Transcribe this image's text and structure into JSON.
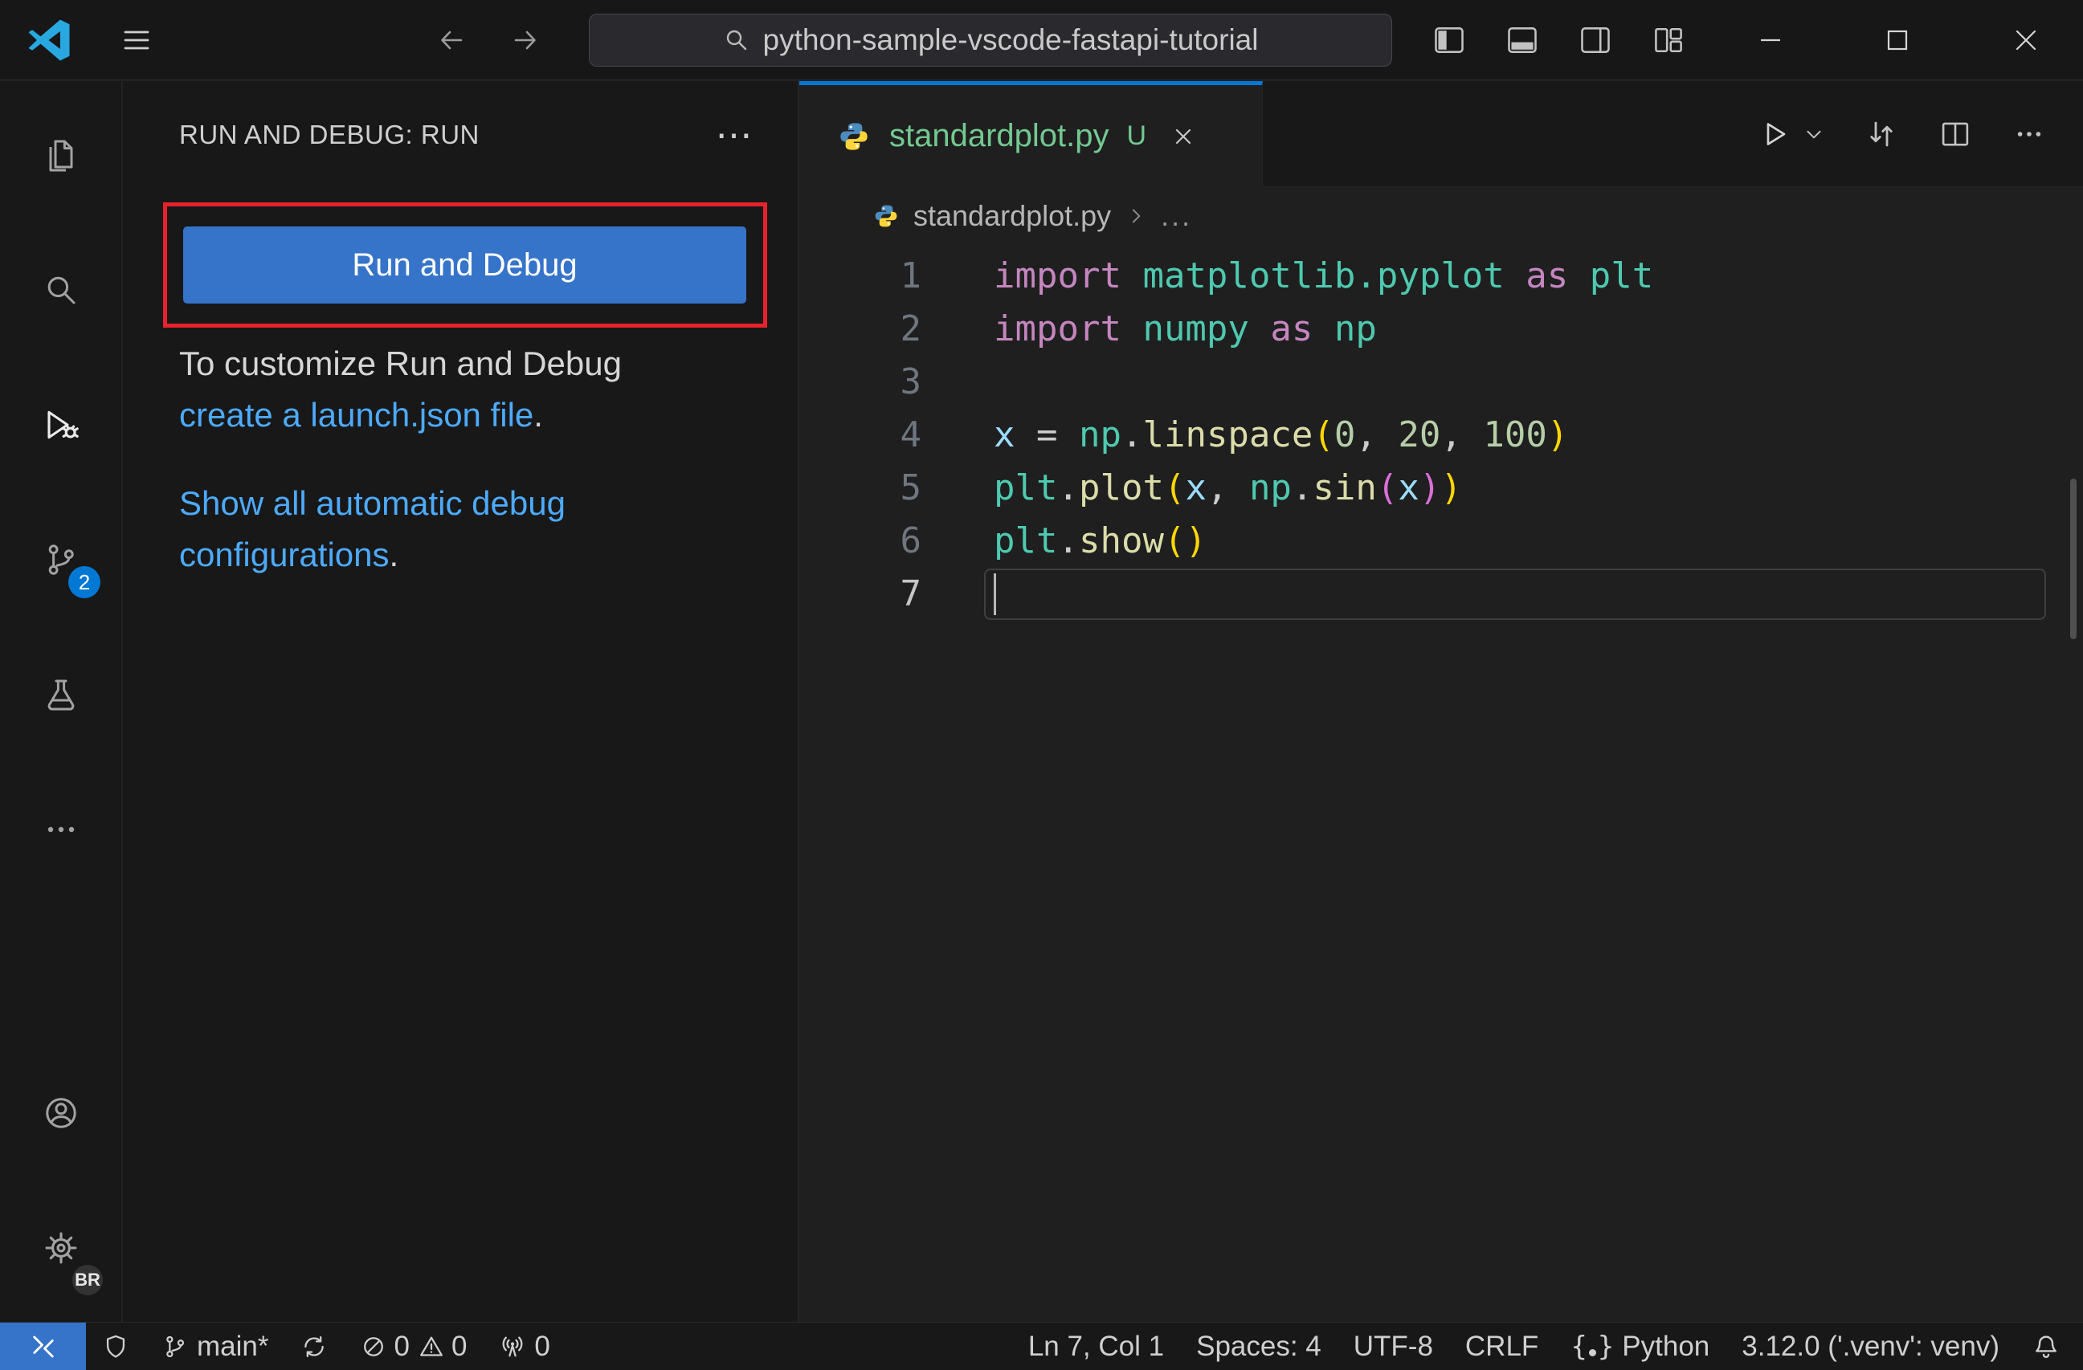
{
  "colors": {
    "accent_blue": "#3574c9",
    "tab_accent": "#0078d4",
    "link_blue": "#4daafc",
    "badge_blue": "#0078d4",
    "annotation_red": "#e8222c",
    "untracked_green": "#73c991"
  },
  "icons": {
    "titlebar": [
      "vscode-logo",
      "menu",
      "back-arrow",
      "forward-arrow",
      "search-magnifier",
      "toggle-sidebar",
      "toggle-panel",
      "toggle-secondary-sidebar",
      "customize-layout",
      "minimize",
      "maximize",
      "close"
    ],
    "activity_bar": [
      "files",
      "search",
      "run-and-debug",
      "source-control",
      "testing-beaker",
      "more-ellipsis",
      "account",
      "settings-gear"
    ],
    "editor": [
      "python-file",
      "tab-close-x",
      "run-play",
      "chevron-down",
      "open-changes",
      "split-editor",
      "more-ellipsis"
    ],
    "status_bar": [
      "remote",
      "shield",
      "git-branch",
      "sync",
      "error-circle-slash",
      "warning-triangle",
      "radio-tower",
      "braces",
      "bell"
    ]
  },
  "titlebar": {
    "search_value": "python-sample-vscode-fastapi-tutorial"
  },
  "activity_bar": {
    "active_item": "run-and-debug",
    "source_control_badge": "2",
    "account_badge": "BR"
  },
  "sidebar": {
    "title": "RUN AND DEBUG: RUN",
    "more_label": "⋯",
    "run_button_label": "Run and Debug",
    "customize_line1": "To customize Run and Debug",
    "customize_link": "create a launch.json file",
    "customize_suffix": ".",
    "show_link_line1": "Show all automatic debug",
    "show_link_line2": "configurations",
    "show_suffix": "."
  },
  "editor": {
    "tab": {
      "label": "standardplot.py",
      "dirty": "U"
    },
    "breadcrumb": {
      "file": "standardplot.py",
      "more": "..."
    },
    "palette": {
      "keyword": "#C586C0",
      "module": "#4EC9B0",
      "function": "#DCDCAA",
      "variable": "#9CDCFE",
      "number": "#B5CEA8",
      "plain": "#CCCCCC",
      "bracket1": "#FFD700",
      "bracket2": "#DA70D6"
    },
    "code_lines": [
      {
        "num": "1",
        "tokens": [
          {
            "t": "import",
            "c": "keyword"
          },
          {
            "t": " ",
            "c": "plain"
          },
          {
            "t": "matplotlib.pyplot",
            "c": "module"
          },
          {
            "t": " ",
            "c": "plain"
          },
          {
            "t": "as",
            "c": "keyword"
          },
          {
            "t": " ",
            "c": "plain"
          },
          {
            "t": "plt",
            "c": "module"
          }
        ]
      },
      {
        "num": "2",
        "tokens": [
          {
            "t": "import",
            "c": "keyword"
          },
          {
            "t": " ",
            "c": "plain"
          },
          {
            "t": "numpy",
            "c": "module"
          },
          {
            "t": " ",
            "c": "plain"
          },
          {
            "t": "as",
            "c": "keyword"
          },
          {
            "t": " ",
            "c": "plain"
          },
          {
            "t": "np",
            "c": "module"
          }
        ]
      },
      {
        "num": "3",
        "tokens": []
      },
      {
        "num": "4",
        "tokens": [
          {
            "t": "x",
            "c": "variable"
          },
          {
            "t": " = ",
            "c": "plain"
          },
          {
            "t": "np",
            "c": "module"
          },
          {
            "t": ".",
            "c": "plain"
          },
          {
            "t": "linspace",
            "c": "function"
          },
          {
            "t": "(",
            "c": "bracket1"
          },
          {
            "t": "0",
            "c": "number"
          },
          {
            "t": ", ",
            "c": "plain"
          },
          {
            "t": "20",
            "c": "number"
          },
          {
            "t": ", ",
            "c": "plain"
          },
          {
            "t": "100",
            "c": "number"
          },
          {
            "t": ")",
            "c": "bracket1"
          }
        ]
      },
      {
        "num": "5",
        "tokens": [
          {
            "t": "plt",
            "c": "module"
          },
          {
            "t": ".",
            "c": "plain"
          },
          {
            "t": "plot",
            "c": "function"
          },
          {
            "t": "(",
            "c": "bracket1"
          },
          {
            "t": "x",
            "c": "variable"
          },
          {
            "t": ", ",
            "c": "plain"
          },
          {
            "t": "np",
            "c": "module"
          },
          {
            "t": ".",
            "c": "plain"
          },
          {
            "t": "sin",
            "c": "function"
          },
          {
            "t": "(",
            "c": "bracket2"
          },
          {
            "t": "x",
            "c": "variable"
          },
          {
            "t": ")",
            "c": "bracket2"
          },
          {
            "t": ")",
            "c": "bracket1"
          }
        ]
      },
      {
        "num": "6",
        "tokens": [
          {
            "t": "plt",
            "c": "module"
          },
          {
            "t": ".",
            "c": "plain"
          },
          {
            "t": "show",
            "c": "function"
          },
          {
            "t": "(",
            "c": "bracket1"
          },
          {
            "t": ")",
            "c": "bracket1"
          }
        ]
      },
      {
        "num": "7",
        "tokens": [],
        "current": true
      }
    ]
  },
  "status_bar": {
    "branch": "main*",
    "errors": "0",
    "warnings": "0",
    "ports": "0",
    "cursor_position": "Ln 7, Col 1",
    "indentation": "Spaces: 4",
    "encoding": "UTF-8",
    "eol": "CRLF",
    "language": "Python",
    "interpreter": "3.12.0 ('.venv': venv)"
  }
}
